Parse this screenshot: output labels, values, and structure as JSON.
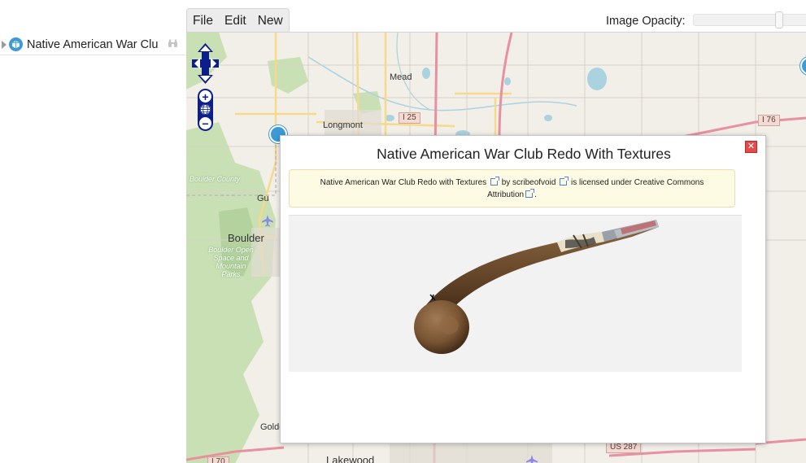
{
  "tree": {
    "item_label": "Native American War Clu",
    "item_icon": "object-icon",
    "action_icon": "binoculars-icon"
  },
  "menu": {
    "file": "File",
    "edit": "Edit",
    "new": "New"
  },
  "opacity": {
    "label": "Image Opacity:",
    "value": 0.78
  },
  "map": {
    "places": {
      "mead": "Mead",
      "longmont": "Longmont",
      "boulder_county": "Boulder County",
      "boulder": "Boulder",
      "gu": "Gu",
      "boulder_open_space": "Boulder Open Space and Mountain Parks",
      "golden": "Golde",
      "lakewood": "Lakewood"
    },
    "shields": {
      "i25": "I 25",
      "i76": "I 76",
      "us287": "US 287",
      "i70": "I 70"
    },
    "colors": {
      "land": "#f2efe9",
      "park": "#c8e0b4",
      "water": "#aad3df",
      "motorway": "#e990a0"
    }
  },
  "popup": {
    "title": "Native American War Club Redo With Textures",
    "attribution": {
      "work": "Native American War Club Redo with Textures",
      "by": "by",
      "author": "scribeofvoid",
      "licensed": "is licensed under Creative Commons",
      "license": "Attribution",
      "end": "."
    }
  }
}
